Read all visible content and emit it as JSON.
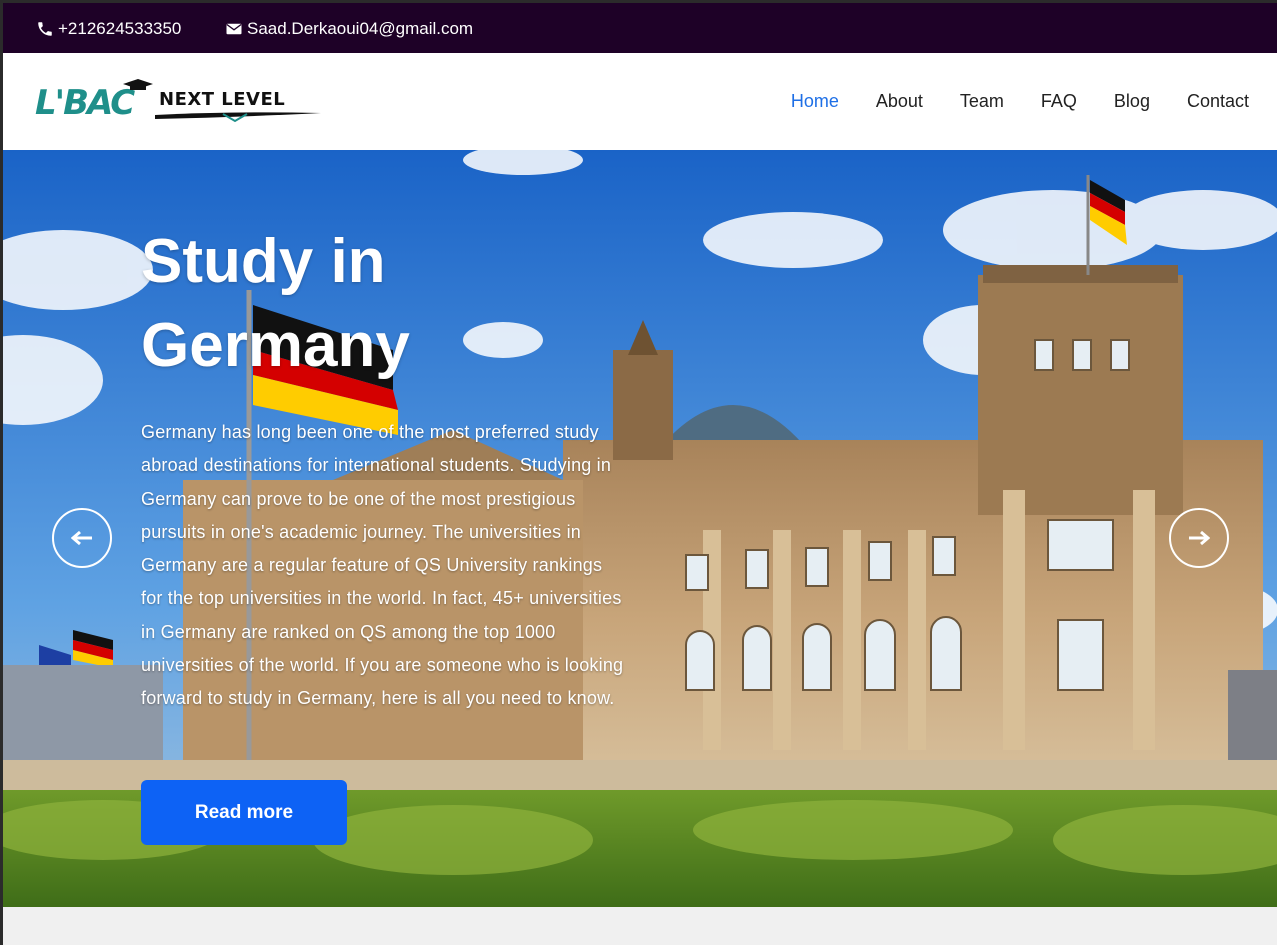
{
  "topbar": {
    "phone": "+212624533350",
    "email": "Saad.Derkaoui04@gmail.com",
    "phone_icon": "phone-icon",
    "email_icon": "envelope-icon"
  },
  "brand": {
    "logo_main": "L'BAC",
    "logo_sub": "NEXT LEVEL"
  },
  "nav": {
    "items": [
      {
        "label": "Home",
        "active": true
      },
      {
        "label": "About"
      },
      {
        "label": "Team"
      },
      {
        "label": "FAQ"
      },
      {
        "label": "Blog"
      },
      {
        "label": "Contact"
      }
    ]
  },
  "hero": {
    "title_line1": "Study in",
    "title_line2": "Germany",
    "body": "Germany has long been one of the most preferred study abroad destinations for international students. Studying in Germany can prove to be one of the most prestigious pursuits in one's academic journey. The universities in Germany are a regular feature of QS University rankings for the top universities in the world. In fact, 45+ universities in Germany are ranked on QS among the top 1000 universities of the world. If you are someone who is looking forward to study in Germany, here is all you need to know.",
    "cta": "Read more",
    "prev_icon": "arrow-left-icon",
    "next_icon": "arrow-right-icon"
  },
  "colors": {
    "topbar_bg": "#1e0127",
    "accent": "#0d62f5",
    "nav_active": "#1e6fe6"
  }
}
